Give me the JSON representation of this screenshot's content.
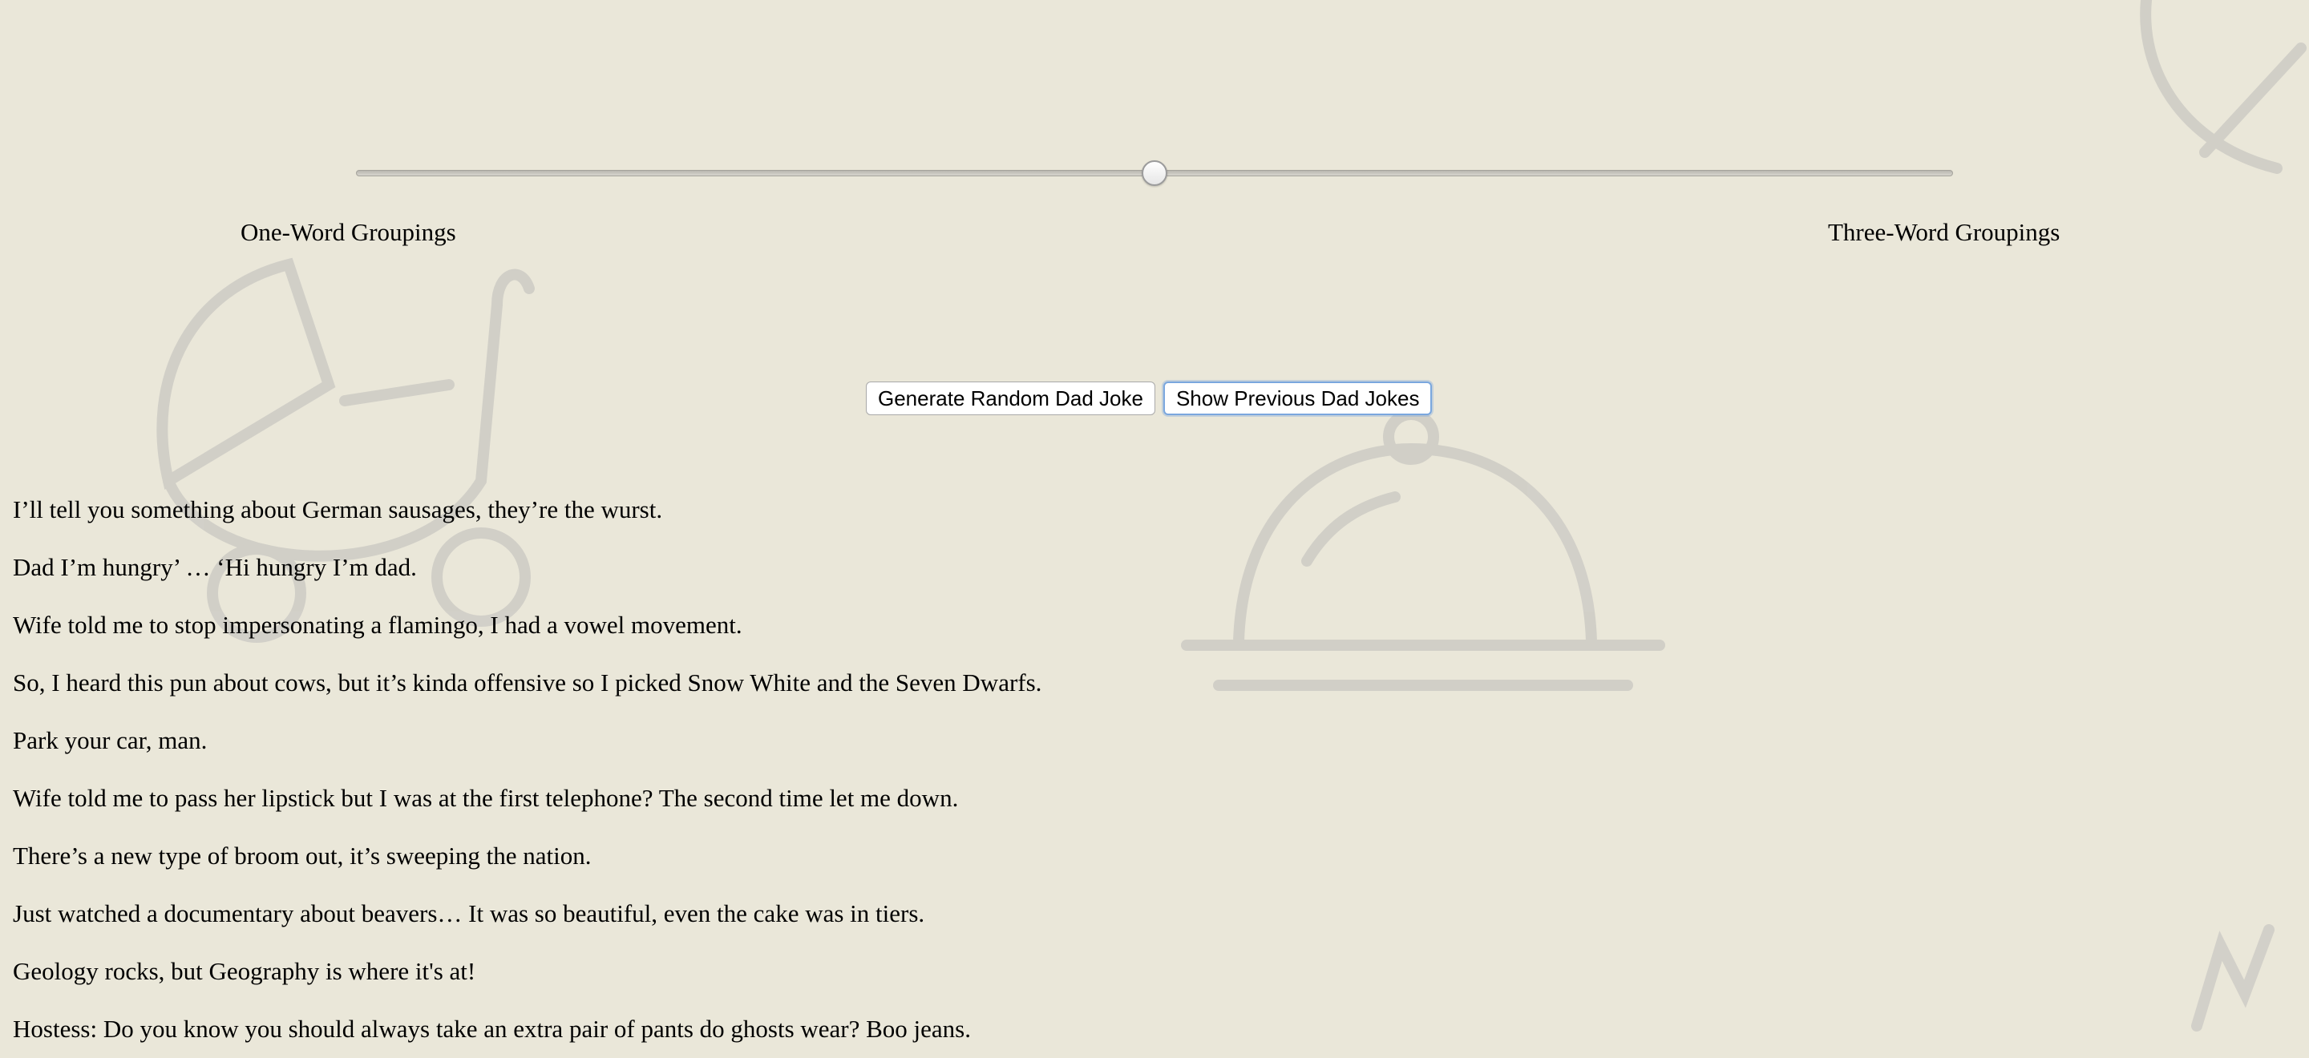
{
  "slider": {
    "value": 0.5,
    "left_label": "One-Word Groupings",
    "right_label": "Three-Word Groupings"
  },
  "buttons": {
    "generate_label": "Generate Random Dad Joke",
    "show_previous_label": "Show Previous Dad Jokes"
  },
  "jokes": [
    "I’ll tell you something about German sausages, they’re the wurst.",
    "Dad I’m hungry’ … ‘Hi hungry I’m dad.",
    "Wife told me to stop impersonating a flamingo, I had a vowel movement.",
    "So, I heard this pun about cows, but it’s kinda offensive so I picked Snow White and the Seven Dwarfs.",
    "Park your car, man.",
    "Wife told me to pass her lipstick but I was at the first telephone? The second time let me down.",
    "There’s a new type of broom out, it’s sweeping the nation.",
    "Just watched a documentary about beavers… It was so beautiful, even the cake was in tiers.",
    "Geology rocks, but Geography is where it's at!",
    "Hostess: Do you know you should always take an extra pair of pants do ghosts wear? Boo jeans."
  ],
  "colors": {
    "background": "#eae7d9",
    "focus_ring": "#7aa7de"
  },
  "background_icons": [
    "baby-carriage-icon",
    "serving-cloche-icon",
    "decorative-corner-icon"
  ]
}
